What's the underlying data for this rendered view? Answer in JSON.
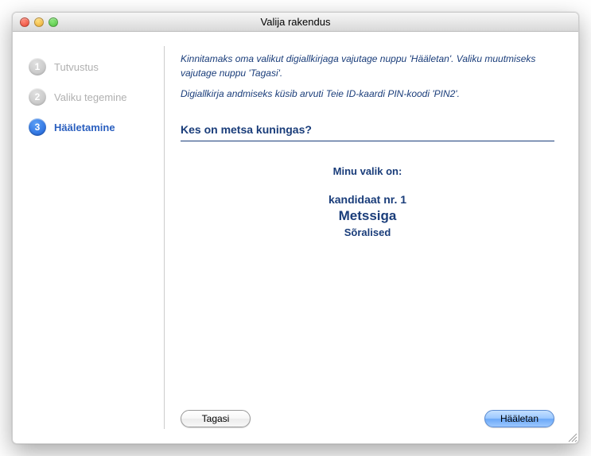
{
  "window": {
    "title": "Valija rakendus"
  },
  "sidebar": {
    "steps": [
      {
        "num": "1",
        "label": "Tutvustus",
        "active": false
      },
      {
        "num": "2",
        "label": "Valiku tegemine",
        "active": false
      },
      {
        "num": "3",
        "label": "Hääletamine",
        "active": true
      }
    ]
  },
  "main": {
    "instruction1": "Kinnitamaks oma valikut digiallkirjaga vajutage nuppu 'Hääletan'. Valiku muutmiseks vajutage nuppu 'Tagasi'.",
    "instruction2": "Digiallkirja andmiseks küsib arvuti Teie ID-kaardi PIN-koodi 'PIN2'.",
    "question": "Kes on metsa kuningas?",
    "selection_lead": "Minu valik on:",
    "candidate_number": "kandidaat nr. 1",
    "candidate_name": "Metssiga",
    "party": "Sõralised"
  },
  "footer": {
    "back_label": "Tagasi",
    "vote_label": "Hääletan"
  }
}
